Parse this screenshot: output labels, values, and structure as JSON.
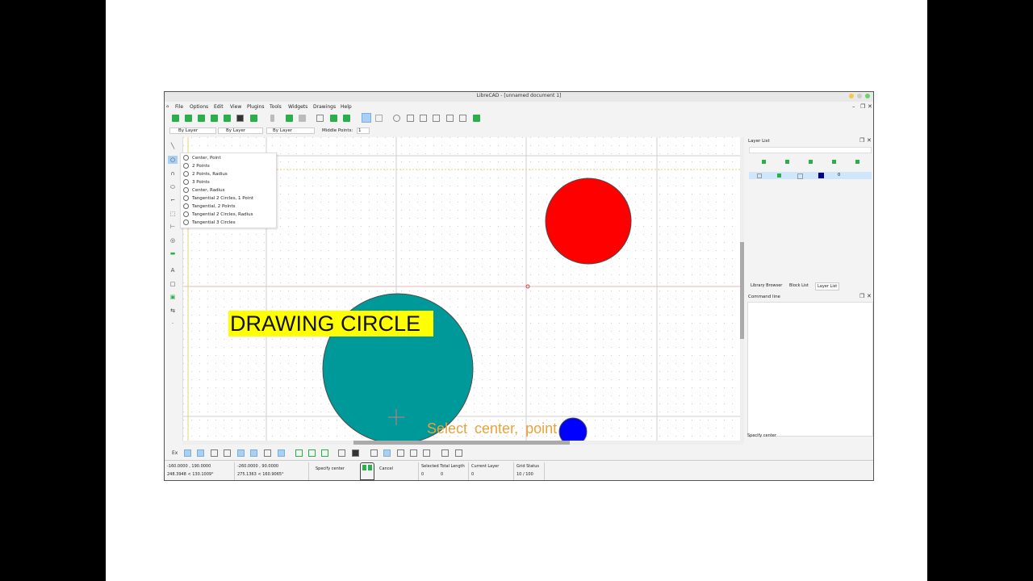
{
  "window": {
    "title": "LibreCAD - [unnamed document 1]"
  },
  "menu": [
    "File",
    "Options",
    "Edit",
    "View",
    "Plugins",
    "Tools",
    "Widgets",
    "Drawings",
    "Help"
  ],
  "properties": {
    "pen": "By Layer",
    "line_type": "By Layer",
    "line_width": "By Layer",
    "middle_points_label": "Middle Points:",
    "middle_points_value": "1"
  },
  "circle_menu": [
    "Center, Point",
    "2 Points",
    "2 Points, Radius",
    "3 Points",
    "Center, Radius",
    "Tangential 2 Circles, 1 Point",
    "Tangential, 2 Points",
    "Tangential 2 Circles, Radius",
    "Tangential 3 Circles"
  ],
  "right_panel": {
    "layer_list_title": "Layer List",
    "layer_name": "0",
    "tabs": [
      "Library Browser",
      "Block List",
      "Layer List"
    ],
    "command_line_title": "Command line",
    "command_output": "Specify center"
  },
  "status": {
    "abs_coord": "-160.0000 , 190.0000",
    "abs_polar": "248.3948 < 130.1009°",
    "rel_coord": "-260.0000 , 90.0000",
    "rel_polar": "275.1363 < 160.9065°",
    "mouse_left": "Specify center",
    "mouse_right": "Cancel",
    "selected_total_length_label": "Selected Total Length",
    "selected_value": "0",
    "total_length_value": "0",
    "current_layer_label": "Current Layer",
    "current_layer_value": "0",
    "grid_status_label": "Grid Status",
    "grid_status_value": "10 / 100",
    "extra_label": "Ex"
  },
  "drawing": {
    "circles": [
      {
        "name": "teal",
        "color": "#009999"
      },
      {
        "name": "red",
        "color": "#ff0000"
      },
      {
        "name": "blue",
        "color": "#0000ff"
      }
    ]
  },
  "overlay": {
    "title": "DRAWING CIRCLE",
    "prompt": "Select  center,  point"
  }
}
